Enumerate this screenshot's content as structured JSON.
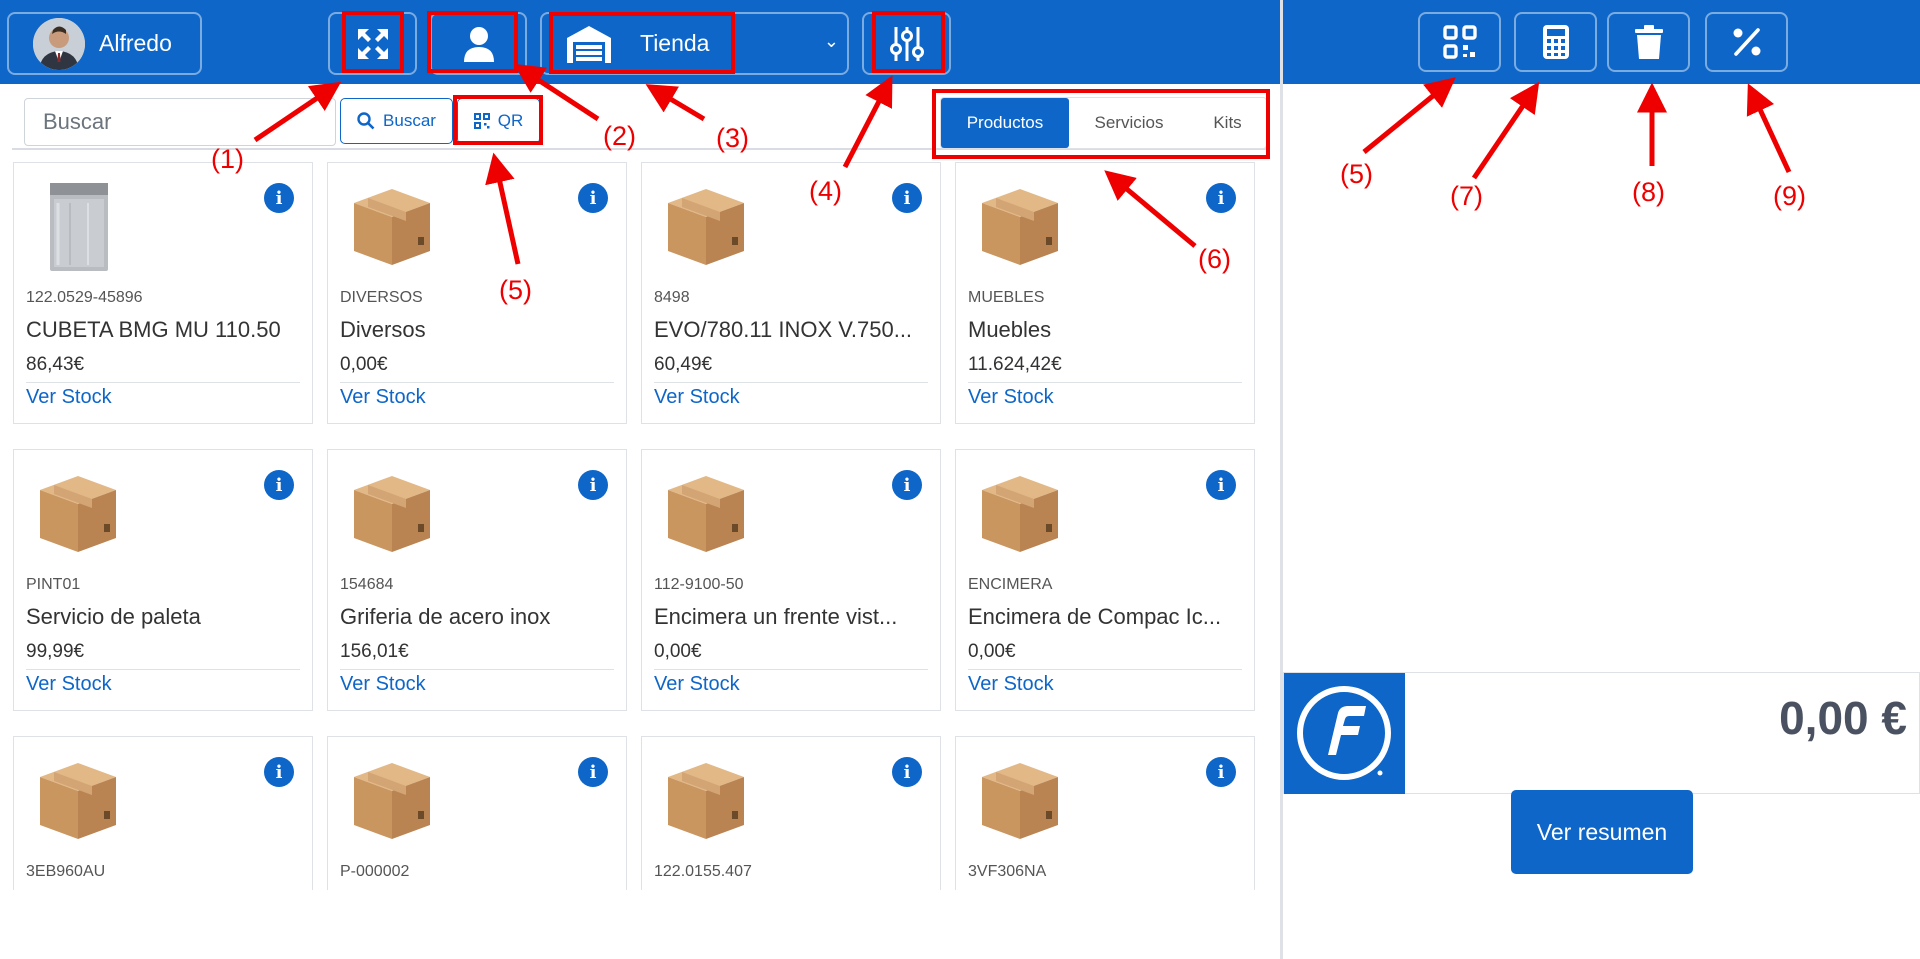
{
  "header": {
    "user_name": "Alfredo",
    "store_label": "Tienda",
    "icons": [
      "expand-icon",
      "user-icon",
      "garage-icon",
      "chevron-down-icon",
      "sliders-icon"
    ]
  },
  "search": {
    "placeholder": "Buscar",
    "button_label": "Buscar",
    "qr_label": "QR"
  },
  "tabs": [
    {
      "label": "Productos",
      "active": true
    },
    {
      "label": "Servicios",
      "active": false
    },
    {
      "label": "Kits",
      "active": false
    }
  ],
  "products": [
    {
      "code": "122.0529-45896",
      "name": "CUBETA BMG MU 110.50",
      "price": "86,43€",
      "stock_label": "Ver Stock",
      "image": "dishwasher"
    },
    {
      "code": "DIVERSOS",
      "name": "Diversos",
      "price": "0,00€",
      "stock_label": "Ver Stock",
      "image": "box"
    },
    {
      "code": "8498",
      "name": "EVO/780.11 INOX V.750...",
      "price": "60,49€",
      "stock_label": "Ver Stock",
      "image": "box"
    },
    {
      "code": "MUEBLES",
      "name": "Muebles",
      "price": "11.624,42€",
      "stock_label": "Ver Stock",
      "image": "box"
    },
    {
      "code": "PINT01",
      "name": "Servicio de paleta",
      "price": "99,99€",
      "stock_label": "Ver Stock",
      "image": "box"
    },
    {
      "code": "154684",
      "name": "Griferia de acero inox",
      "price": "156,01€",
      "stock_label": "Ver Stock",
      "image": "box"
    },
    {
      "code": "112-9100-50",
      "name": "Encimera un frente vist...",
      "price": "0,00€",
      "stock_label": "Ver Stock",
      "image": "box"
    },
    {
      "code": "ENCIMERA",
      "name": "Encimera de Compac Ic...",
      "price": "0,00€",
      "stock_label": "Ver Stock",
      "image": "box"
    },
    {
      "code": "3EB960AU",
      "name": "",
      "price": "",
      "stock_label": "",
      "image": "box"
    },
    {
      "code": "P-000002",
      "name": "",
      "price": "",
      "stock_label": "",
      "image": "box"
    },
    {
      "code": "122.0155.407",
      "name": "",
      "price": "",
      "stock_label": "",
      "image": "box"
    },
    {
      "code": "3VF306NA",
      "name": "",
      "price": "",
      "stock_label": "",
      "image": "box"
    }
  ],
  "right_panel": {
    "icons": [
      "qr-scan-icon",
      "calculator-icon",
      "trash-icon",
      "percent-icon"
    ],
    "total": "0,00 €",
    "summary_label": "Ver resumen"
  },
  "annotations": [
    "(1)",
    "(2)",
    "(3)",
    "(4)",
    "(5)",
    "(5)",
    "(6)",
    "(7)",
    "(8)",
    "(9)"
  ],
  "colors": {
    "primary": "#0d66c8",
    "annotation": "#ee0000"
  }
}
